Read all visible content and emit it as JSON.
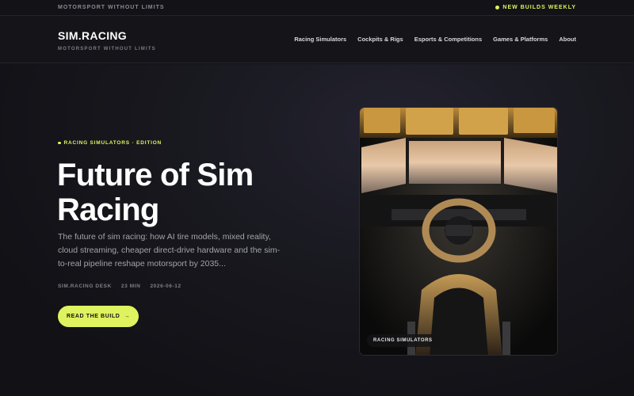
{
  "topbar": {
    "tagline": "MOTORSPORT WITHOUT LIMITS",
    "notice": "NEW BUILDS WEEKLY"
  },
  "brand": {
    "logo": "SIM.RACING",
    "subtitle": "MOTORSPORT WITHOUT LIMITS"
  },
  "nav": {
    "items": [
      "Racing Simulators",
      "Cockpits & Rigs",
      "Esports & Competitions",
      "Games & Platforms",
      "About"
    ]
  },
  "hero": {
    "eyebrow": "RACING SIMULATORS · EDITION",
    "title": "Future of Sim Racing",
    "description": "The future of sim racing: how AI tire models, mixed reality, cloud streaming, cheaper direct-drive hardware and the sim-to-real pipeline reshape motorsport by 2035...",
    "meta": {
      "author": "SIM.RACING DESK",
      "read_time": "23 MIN",
      "date": "2026-06-12"
    },
    "cta_label": "READ THE BUILD",
    "cta_arrow": "→",
    "image_badge": "RACING SIMULATORS"
  },
  "colors": {
    "accent": "#dff25f",
    "background": "#111116"
  }
}
